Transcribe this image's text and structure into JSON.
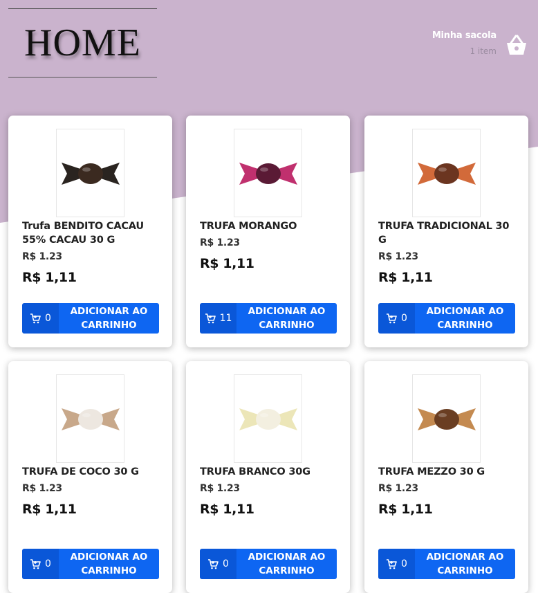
{
  "header": {
    "logo_text": "HOME",
    "bag_title": "Minha sacola",
    "bag_count": "1 item"
  },
  "colors": {
    "header_bg": "#cab3cd",
    "accent": "#0e66f2",
    "accent_dark": "#0a57d8"
  },
  "products": [
    {
      "name": "Trufa BENDITO CACAU 55% CACAU 30 G",
      "price_old": "R$ 1.23",
      "price": "R$ 1,11",
      "qty": "0",
      "button_label": "ADICIONAR AO CARRINHO",
      "wrapper_color": "#2a2420",
      "ball_color": "#3b2a20"
    },
    {
      "name": "TRUFA MORANGO",
      "price_old": "R$ 1.23",
      "price": "R$ 1,11",
      "qty": "11",
      "button_label": "ADICIONAR AO CARRINHO",
      "wrapper_color": "#c0306e",
      "ball_color": "#5a1a35"
    },
    {
      "name": "TRUFA TRADICIONAL 30 G",
      "price_old": "R$ 1.23",
      "price": "R$ 1,11",
      "qty": "0",
      "button_label": "ADICIONAR AO CARRINHO",
      "wrapper_color": "#d26a3a",
      "ball_color": "#6b3520"
    },
    {
      "name": "TRUFA DE COCO 30 G",
      "price_old": "R$ 1.23",
      "price": "R$ 1,11",
      "qty": "0",
      "button_label": "ADICIONAR AO CARRINHO",
      "wrapper_color": "#c8a88a",
      "ball_color": "#ede7e0"
    },
    {
      "name": "TRUFA BRANCO 30G",
      "price_old": "R$ 1.23",
      "price": "R$ 1,11",
      "qty": "0",
      "button_label": "ADICIONAR AO CARRINHO",
      "wrapper_color": "#ece6b8",
      "ball_color": "#f3efe0"
    },
    {
      "name": "TRUFA MEZZO 30 G",
      "price_old": "R$ 1.23",
      "price": "R$ 1,11",
      "qty": "0",
      "button_label": "ADICIONAR AO CARRINHO",
      "wrapper_color": "#c48a50",
      "ball_color": "#6a3e22"
    }
  ]
}
